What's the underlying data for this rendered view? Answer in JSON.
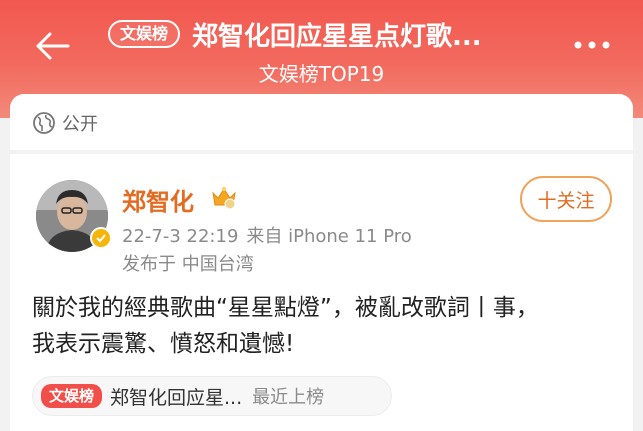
{
  "header": {
    "back_icon": "arrow-left-icon",
    "badge": "文娱榜",
    "title": "郑智化回应星星点灯歌...",
    "subtitle": "文娱榜TOP19",
    "more_icon": "more-dots-icon",
    "bg_color": "#f2584f"
  },
  "visibility": {
    "icon": "globe-icon",
    "label": "公开"
  },
  "post": {
    "author": "郑智化",
    "author_color": "#e36c22",
    "follow_label": "十关注",
    "date": "22-7-3 22:19",
    "source": "来自 iPhone 11 Pro",
    "location": "发布于 中国台湾",
    "text_line1": "關於我的經典歌曲“星星點燈”，被亂改歌詞丨事，",
    "text_line2": "我表示震驚、憤怒和遺憾!"
  },
  "topic_chip": {
    "badge": "文娱榜",
    "title": "郑智化回应星...",
    "status": "最近上榜"
  }
}
